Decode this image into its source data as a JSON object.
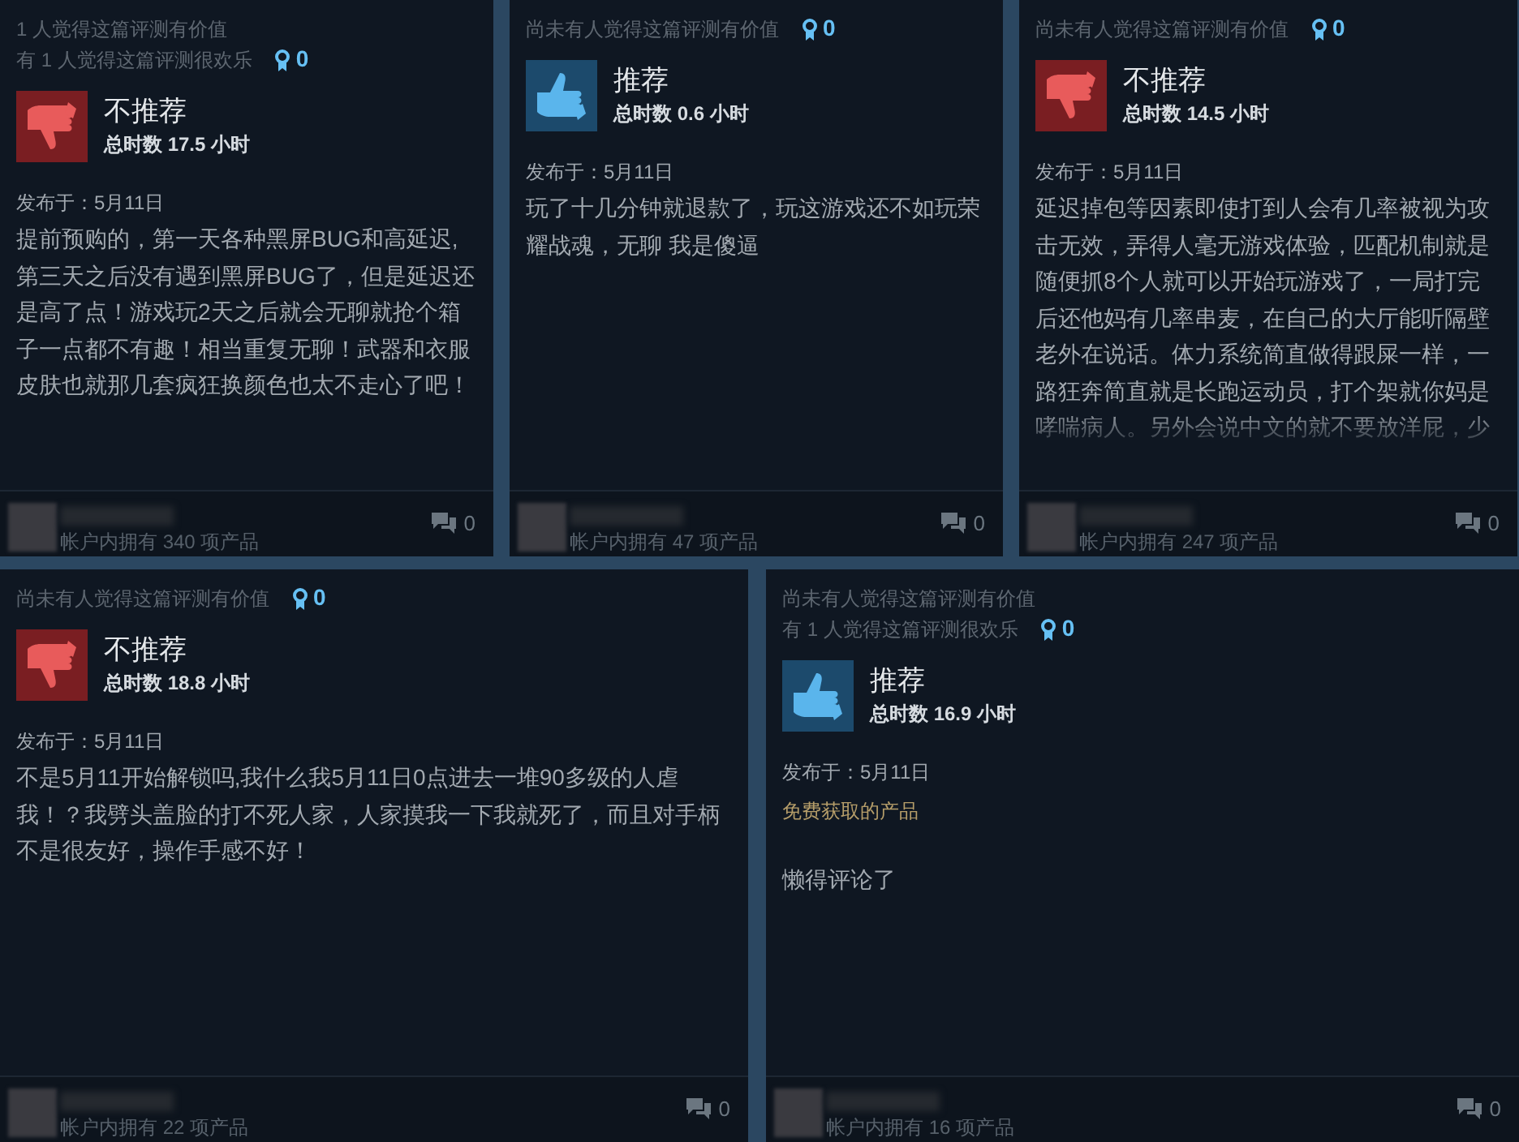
{
  "reviews": [
    {
      "helpful": [
        "1 人觉得这篇评测有价值",
        "有 1 人觉得这篇评测很欢乐"
      ],
      "awards": "0",
      "kind": "down",
      "verdict": "不推荐",
      "hours": "总时数 17.5 小时",
      "posted": "发布于：5月11日",
      "body": "提前预购的，第一天各种黑屏BUG和高延迟,第三天之后没有遇到黑屏BUG了，但是延迟还是高了点！游戏玩2天之后就会无聊就抢个箱子一点都不有趣！相当重复无聊！武器和衣服皮肤也就那几套疯狂换颜色也太不走心了吧！",
      "faded": false,
      "products": "帐户内拥有 340 项产品",
      "comments": "0"
    },
    {
      "helpful": [
        "尚未有人觉得这篇评测有价值"
      ],
      "awards": "0",
      "kind": "up",
      "verdict": "推荐",
      "hours": "总时数 0.6 小时",
      "posted": "发布于：5月11日",
      "body": "玩了十几分钟就退款了，玩这游戏还不如玩荣耀战魂，无聊 我是傻逼",
      "faded": false,
      "products": "帐户内拥有 47 项产品",
      "comments": "0"
    },
    {
      "helpful": [
        "尚未有人觉得这篇评测有价值"
      ],
      "awards": "0",
      "kind": "down",
      "verdict": "不推荐",
      "hours": "总时数 14.5 小时",
      "posted": "发布于：5月11日",
      "body": "延迟掉包等因素即使打到人会有几率被视为攻击无效，弄得人毫无游戏体验，匹配机制就是随便抓8个人就可以开始玩游戏了，一局打完后还他妈有几率串麦，在自己的大厅能听隔壁老外在说话。体力系统简直做得跟屎一样，一路狂奔简直就是长跑运动员，打个架就你妈是哮喘病人。另外会说中文的就不要放洋屁，少",
      "faded": true,
      "products": "帐户内拥有 247 项产品",
      "comments": "0"
    },
    {
      "helpful": [
        "尚未有人觉得这篇评测有价值"
      ],
      "awards": "0",
      "kind": "down",
      "verdict": "不推荐",
      "hours": "总时数 18.8 小时",
      "posted": "发布于：5月11日",
      "body": "不是5月11开始解锁吗,我什么我5月11日0点进去一堆90多级的人虐我！？我劈头盖脸的打不死人家，人家摸我一下我就死了，而且对手柄不是很友好，操作手感不好！",
      "faded": false,
      "products": "帐户内拥有 22 项产品",
      "comments": "0"
    },
    {
      "helpful": [
        "尚未有人觉得这篇评测有价值",
        "有 1 人觉得这篇评测很欢乐"
      ],
      "awards": "0",
      "kind": "up",
      "verdict": "推荐",
      "hours": "总时数 16.9 小时",
      "posted": "发布于：5月11日",
      "note": "免费获取的产品",
      "body": "懒得评论了",
      "faded": false,
      "products": "帐户内拥有 16 项产品",
      "comments": "0"
    }
  ]
}
